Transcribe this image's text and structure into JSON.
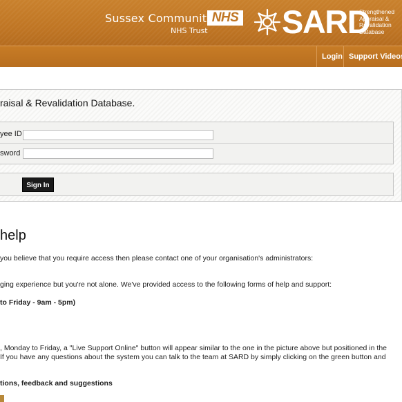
{
  "header": {
    "trust_name": "Sussex Community",
    "trust_sub": "NHS Trust",
    "nhs_logo": "NHS",
    "sard_logo": "SARD",
    "sard_tagline": [
      "Strengthened",
      "Appraisal &",
      "Revalidation",
      "Database"
    ],
    "emblem_icon": "sard-knot-emblem"
  },
  "nav": {
    "login": "Login",
    "support_videos": "Support Videos"
  },
  "login": {
    "title": "raisal & Revalidation Database.",
    "employee_id_label": "yee ID",
    "password_label": "sword",
    "employee_id_value": "",
    "password_value": "",
    "sign_in": "Sign In"
  },
  "help": {
    "title": "help",
    "lines": [
      "you believe that you require access then please contact one of your organisation's administrators:",
      "ging experience but you're not alone. We've provided access to the following forms of help and support:",
      "to Friday - 9am - 5pm)",
      ", Monday to Friday, a \"Live Support Online\" button will appear similar to the one in the picture above but positioned in the",
      "If you have any questions about the system you can talk to the team at SARD by simply clicking on the green button and",
      "tions, feedback and suggestions"
    ]
  },
  "colors": {
    "header_bg": "#c07624",
    "button_bg": "#1a1a1a"
  }
}
